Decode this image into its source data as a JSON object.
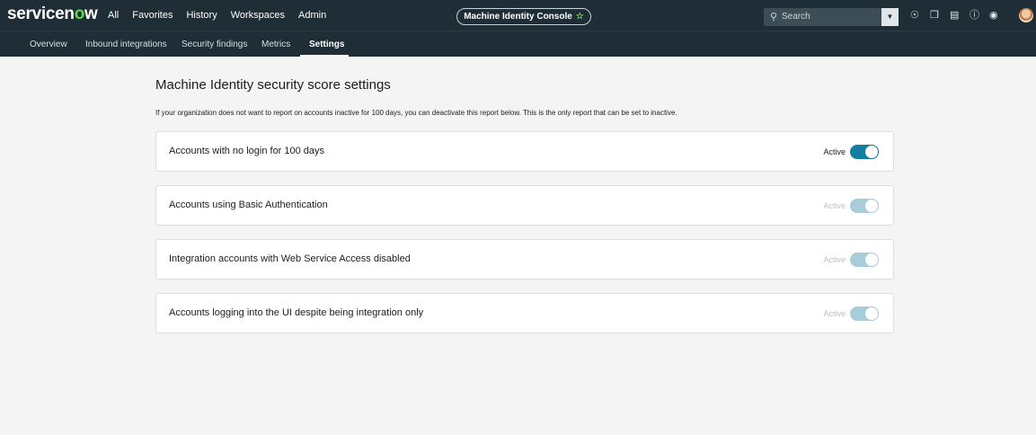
{
  "app": {
    "logo_prefix": "servicen",
    "logo_o": "o",
    "logo_suffix": "w"
  },
  "topnav": [
    "All",
    "Favorites",
    "History",
    "Workspaces",
    "Admin"
  ],
  "console": {
    "title": "Machine Identity Console",
    "star": "☆"
  },
  "search": {
    "placeholder": "Search"
  },
  "header_icons": [
    "globe-icon",
    "chat-icon",
    "list-icon",
    "help-icon",
    "bell-icon",
    "avatar"
  ],
  "tabs": [
    {
      "label": "Overview",
      "active": false
    },
    {
      "label": "Inbound integrations",
      "active": false
    },
    {
      "label": "Security findings",
      "active": false
    },
    {
      "label": "Metrics",
      "active": false
    },
    {
      "label": "Settings",
      "active": true
    }
  ],
  "main": {
    "title": "Machine Identity security score settings",
    "description": "If your organization does not want to report on accounts inactive for 100 days, you can deactivate this report below. This is the only report that can be set to inactive.",
    "settings": [
      {
        "label": "Accounts with no login for 100 days",
        "status": "Active",
        "enabled": true,
        "disabled": false
      },
      {
        "label": "Accounts using Basic Authentication",
        "status": "Active",
        "enabled": true,
        "disabled": true
      },
      {
        "label": "Integration accounts with Web Service Access disabled",
        "status": "Active",
        "enabled": true,
        "disabled": true
      },
      {
        "label": "Accounts logging into the UI despite being integration only",
        "status": "Active",
        "enabled": true,
        "disabled": true
      }
    ]
  }
}
